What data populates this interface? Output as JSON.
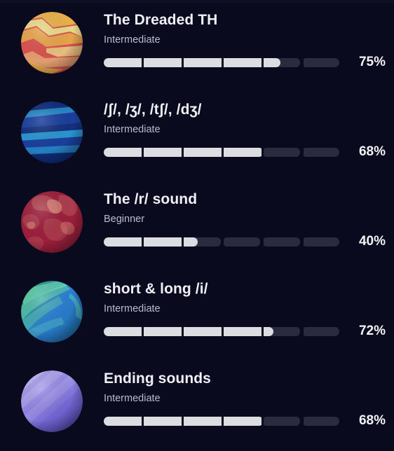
{
  "screen": {
    "background_color": "#0a0a1e",
    "progress_fill_color": "#dcdde1",
    "progress_track_color": "#2b2b3f",
    "segment_count": 6
  },
  "lessons": [
    {
      "title": "The Dreaded TH",
      "level": "Intermediate",
      "percent_label": "75%",
      "percent": 75,
      "icon": "planet-mars-icon",
      "planet_colors": [
        "#e8b14a",
        "#d9534f",
        "#e8d98a",
        "#c9443f"
      ]
    },
    {
      "title": "/ʃ/, /ʒ/, /tʃ/, /dʒ/",
      "level": "Intermediate",
      "percent_label": "68%",
      "percent": 68,
      "icon": "planet-neptune-icon",
      "planet_colors": [
        "#1b3f9c",
        "#0f2d7a",
        "#2b9fd4",
        "#14307f"
      ]
    },
    {
      "title": "The /r/ sound",
      "level": "Beginner",
      "percent_label": "40%",
      "percent": 40,
      "icon": "planet-crimson-icon",
      "planet_colors": [
        "#9c1f3c",
        "#7a1b33",
        "#d98a7a",
        "#b24a55"
      ]
    },
    {
      "title": "short & long /i/",
      "level": "Intermediate",
      "percent_label": "72%",
      "percent": 72,
      "icon": "planet-aqua-icon",
      "planet_colors": [
        "#2f9e6e",
        "#6fe0b0",
        "#2b7fd4",
        "#1f6fa8"
      ]
    },
    {
      "title": "Ending sounds",
      "level": "Intermediate",
      "percent_label": "68%",
      "percent": 68,
      "icon": "planet-violet-icon",
      "planet_colors": [
        "#8b7fe0",
        "#b8aef0",
        "#6a5acd",
        "#5a4fc0"
      ]
    }
  ]
}
